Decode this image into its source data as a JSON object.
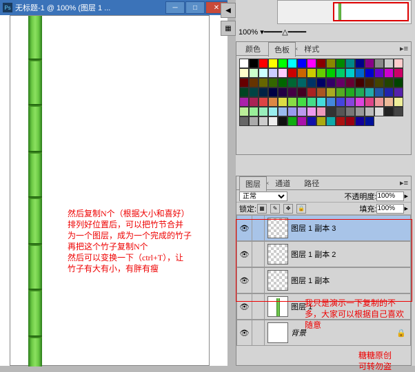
{
  "window": {
    "title": "无标题-1 @ 100% (图层 1 ..."
  },
  "zoom": "100%",
  "colorPanel": {
    "tabs": [
      "颜色",
      "色板",
      "样式"
    ],
    "activeTab": 1
  },
  "layersPanel": {
    "tabs": [
      "图层",
      "通道",
      "路径"
    ],
    "activeTab": 0,
    "blendMode": "正常",
    "opacityLabel": "不透明度:",
    "opacity": "100%",
    "lockLabel": "锁定:",
    "fillLabel": "填充:",
    "fill": "100%",
    "layers": [
      {
        "name": "图层 1 副本 3",
        "visible": true,
        "thumb": "checker",
        "active": true
      },
      {
        "name": "图层 1 副本 2",
        "visible": true,
        "thumb": "checker",
        "active": false
      },
      {
        "name": "图层 1 副本",
        "visible": true,
        "thumb": "checker",
        "active": false
      },
      {
        "name": "图层 1",
        "visible": true,
        "thumb": "bamboo",
        "active": false
      },
      {
        "name": "背景",
        "visible": true,
        "thumb": "bg",
        "active": false,
        "bg": true
      }
    ]
  },
  "annotations": {
    "main": "然后复制N个（根据大小和喜好）\n排列好位置后，可以把竹节合并\n为一个图层，成为一个完成的竹子\n再把这个竹子复制N个\n然后可以变换一下（ctrl+T），让\n竹子有大有小，有胖有瘦",
    "side": "我只是演示一下复制的不\n多，大家可以根据自己喜欢\n随意",
    "credit": "糖糖原创\n可转勿盗"
  },
  "swatchColors": [
    "#fff",
    "#000",
    "#f00",
    "#ff0",
    "#0f0",
    "#0ff",
    "#00f",
    "#f0f",
    "#800",
    "#880",
    "#080",
    "#088",
    "#008",
    "#808",
    "#888",
    "#ccc",
    "#fcc",
    "#ffc",
    "#cfc",
    "#cff",
    "#ccf",
    "#fcf",
    "#c00",
    "#c60",
    "#cc0",
    "#6c0",
    "#0c0",
    "#0c6",
    "#0cc",
    "#06c",
    "#00c",
    "#60c",
    "#c0c",
    "#c06",
    "#600",
    "#630",
    "#660",
    "#360",
    "#060",
    "#063",
    "#066",
    "#036",
    "#006",
    "#306",
    "#606",
    "#603",
    "#400",
    "#420",
    "#440",
    "#240",
    "#040",
    "#042",
    "#044",
    "#024",
    "#004",
    "#204",
    "#404",
    "#402",
    "#a22",
    "#a52",
    "#aa2",
    "#5a2",
    "#2a2",
    "#2a5",
    "#2aa",
    "#25a",
    "#22a",
    "#52a",
    "#a2a",
    "#a25",
    "#d44",
    "#d84",
    "#dd4",
    "#8d4",
    "#4d4",
    "#4d8",
    "#4dd",
    "#48d",
    "#44d",
    "#84d",
    "#d4d",
    "#d48",
    "#e99",
    "#eb9",
    "#ee9",
    "#be9",
    "#9e9",
    "#9eb",
    "#9ee",
    "#9be",
    "#99e",
    "#b9e",
    "#e9e",
    "#e9b",
    "#333",
    "#555",
    "#777",
    "#999",
    "#bbb",
    "#ddd",
    "#222",
    "#444",
    "#666",
    "#aaa",
    "#ccc",
    "#eee",
    "#111",
    "#1a1",
    "#a1a",
    "#11a",
    "#aa1",
    "#1aa",
    "#a11",
    "#901",
    "#109",
    "#019"
  ]
}
